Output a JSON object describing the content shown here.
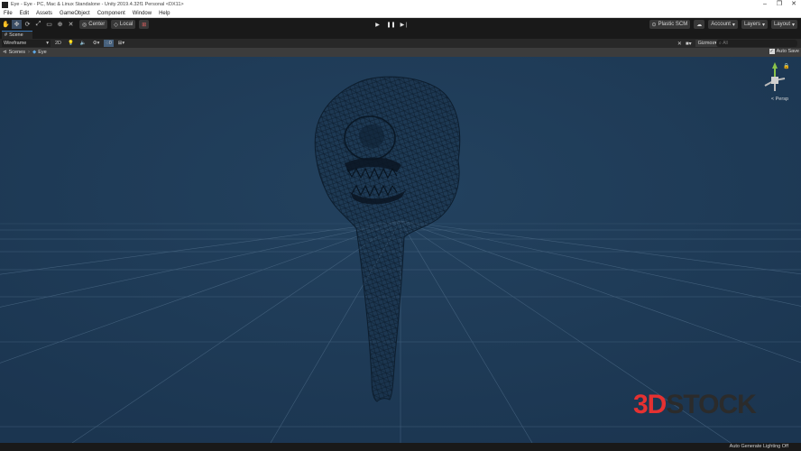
{
  "window": {
    "title": "Eye - Eye - PC, Mac & Linux Standalone - Unity 2019.4.32f1 Personal <DX11>",
    "controls": [
      "–",
      "❐",
      "✕"
    ]
  },
  "menu": [
    "File",
    "Edit",
    "Assets",
    "GameObject",
    "Component",
    "Window",
    "Help"
  ],
  "toolbar": {
    "tools": [
      "hand-tool",
      "move-tool",
      "rotate-tool",
      "scale-tool",
      "rect-tool",
      "transform-tool",
      "custom-tool"
    ],
    "pivot_label": "Center",
    "space_label": "Local",
    "plastic_label": "Plastic SCM",
    "account_label": "Account",
    "layers_label": "Layers",
    "layout_label": "Layout"
  },
  "tabs": {
    "scene_label": "Scene"
  },
  "scene_toolbar": {
    "draw_mode": "Wireframe",
    "mode_2d": "2D",
    "gizmos_label": "Gizmos",
    "search_placeholder": "All",
    "hidden_count": "0"
  },
  "breadcrumb": {
    "root_label": "Scenes",
    "current_label": "Eye",
    "autosave_label": "Auto Save"
  },
  "viewport": {
    "projection_label": "< Persp",
    "background_color": "#1e3a56"
  },
  "watermark": {
    "part1": "3D",
    "part2": "STOCK"
  },
  "status": {
    "message": "Auto Generate Lighting Off"
  },
  "colors": {
    "accent": "#3a79bb",
    "toolbar": "#191919",
    "panel": "#282828",
    "watermark_red": "#e53131"
  }
}
